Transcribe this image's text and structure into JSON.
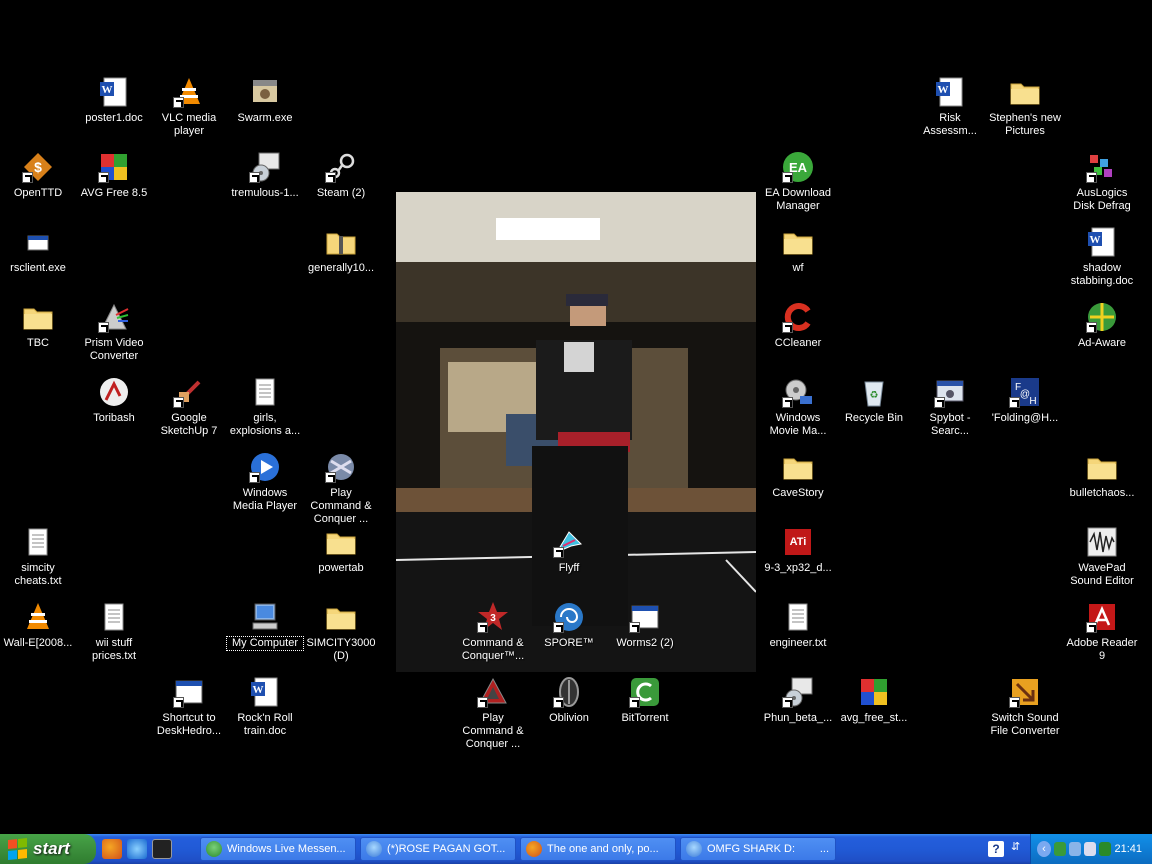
{
  "desktop": {
    "icons": [
      {
        "label": "poster1.doc",
        "icon": "word-doc-icon"
      },
      {
        "label": "VLC media player",
        "icon": "vlc-cone-icon"
      },
      {
        "label": "Swarm.exe",
        "icon": "exe-icon"
      },
      {
        "label": "Risk Assessm...",
        "icon": "word-doc-icon"
      },
      {
        "label": "Stephen's new Pictures",
        "icon": "folder-icon"
      },
      {
        "label": "OpenTTD",
        "icon": "openttd-icon"
      },
      {
        "label": "AVG Free 8.5",
        "icon": "avg-icon"
      },
      {
        "label": "tremulous-1...",
        "icon": "installer-icon"
      },
      {
        "label": "Steam (2)",
        "icon": "steam-icon"
      },
      {
        "label": "EA Download Manager",
        "icon": "ea-icon"
      },
      {
        "label": "AusLogics Disk Defrag",
        "icon": "defrag-icon"
      },
      {
        "label": "rsclient.exe",
        "icon": "exe-icon"
      },
      {
        "label": "generally10...",
        "icon": "zip-folder-icon"
      },
      {
        "label": "wf",
        "icon": "folder-icon"
      },
      {
        "label": "shadow stabbing.doc",
        "icon": "word-doc-icon"
      },
      {
        "label": "TBC",
        "icon": "folder-icon"
      },
      {
        "label": "Prism Video Converter",
        "icon": "prism-icon"
      },
      {
        "label": "CCleaner",
        "icon": "ccleaner-icon"
      },
      {
        "label": "Ad-Aware",
        "icon": "adaware-icon"
      },
      {
        "label": "Toribash",
        "icon": "toribash-icon"
      },
      {
        "label": "Google SketchUp 7",
        "icon": "sketchup-icon"
      },
      {
        "label": "girls, explosions a...",
        "icon": "text-file-icon"
      },
      {
        "label": "Windows Movie Ma...",
        "icon": "movie-maker-icon"
      },
      {
        "label": "Recycle Bin",
        "icon": "recycle-bin-icon"
      },
      {
        "label": "Spybot - Searc...",
        "icon": "spybot-icon"
      },
      {
        "label": "'Folding@H...",
        "icon": "folding-icon"
      },
      {
        "label": "Windows Media Player",
        "icon": "media-player-icon"
      },
      {
        "label": "Play Command & Conquer ...",
        "icon": "cnc-icon"
      },
      {
        "label": "CaveStory",
        "icon": "folder-icon"
      },
      {
        "label": "bulletchaos...",
        "icon": "folder-icon"
      },
      {
        "label": "simcity cheats.txt",
        "icon": "text-file-icon"
      },
      {
        "label": "powertab",
        "icon": "folder-icon"
      },
      {
        "label": "Flyff",
        "icon": "flyff-icon"
      },
      {
        "label": "9-3_xp32_d...",
        "icon": "ati-icon"
      },
      {
        "label": "WavePad Sound Editor",
        "icon": "wavepad-icon"
      },
      {
        "label": "Wall-E[2008...",
        "icon": "vlc-cone-icon"
      },
      {
        "label": "wii stuff prices.txt",
        "icon": "text-file-icon"
      },
      {
        "label": "My Computer",
        "icon": "my-computer-icon"
      },
      {
        "label": "SIMCITY3000 (D)",
        "icon": "folder-icon"
      },
      {
        "label": "Command & Conquer™...",
        "icon": "cnc3-icon"
      },
      {
        "label": "SPORE™",
        "icon": "spore-icon"
      },
      {
        "label": "Worms2 (2)",
        "icon": "window-app-icon"
      },
      {
        "label": "engineer.txt",
        "icon": "text-file-icon"
      },
      {
        "label": "Adobe Reader 9",
        "icon": "adobe-reader-icon"
      },
      {
        "label": "Shortcut to DeskHedro...",
        "icon": "window-app-icon"
      },
      {
        "label": "Rock'n Roll train.doc",
        "icon": "word-doc-icon"
      },
      {
        "label": "Play Command & Conquer ...",
        "icon": "cnc-ra-icon"
      },
      {
        "label": "Oblivion",
        "icon": "oblivion-icon"
      },
      {
        "label": "BitTorrent",
        "icon": "bittorrent-icon"
      },
      {
        "label": "Phun_beta_...",
        "icon": "installer-icon"
      },
      {
        "label": "avg_free_st...",
        "icon": "avg-icon"
      },
      {
        "label": "Switch Sound File Converter",
        "icon": "switch-icon"
      }
    ]
  },
  "taskbar": {
    "start_label": "start",
    "tasks": [
      {
        "label": "Windows Live Messen...",
        "icon": "messenger-icon"
      },
      {
        "label": "(*)ROSE PAGAN GOT...",
        "icon": "messenger-chat-icon"
      },
      {
        "label": "The one and only, po...",
        "icon": "firefox-icon"
      },
      {
        "label": "OMFG SHARK D:",
        "icon": "messenger-chat-icon",
        "extra": "..."
      }
    ],
    "help_label": "?",
    "clock": "21:41"
  }
}
